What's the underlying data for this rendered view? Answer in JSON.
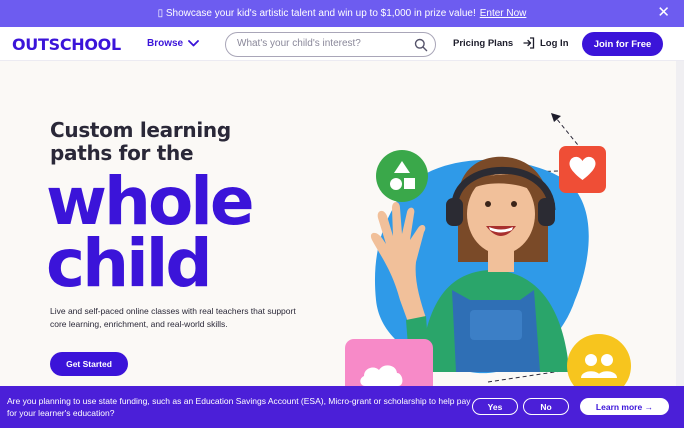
{
  "promo": {
    "text": "▯ Showcase your kid's artistic talent and win up to $1,000 in prize value!",
    "link": "Enter Now",
    "close": "✕"
  },
  "nav": {
    "logo": "OUTSCHOOL",
    "browse": "Browse",
    "search_placeholder": "What's your child's interest?",
    "pricing": "Pricing Plans",
    "login": "Log In",
    "join": "Join for Free"
  },
  "hero": {
    "line1": "Custom learning",
    "line2": "paths for the",
    "big1": "whole",
    "big2": "child",
    "desc": "Live and self-paced online classes with real teachers that support core learning, enrichment, and real-world skills.",
    "cta": "Get Started"
  },
  "banner": {
    "text": "Are you planning to use state funding, such as an Education Savings Account (ESA), Micro-grant or scholarship to help pay for your learner's education?",
    "yes": "Yes",
    "no": "No",
    "more": "Learn more →"
  },
  "colors": {
    "brand": "#3b14d9",
    "promo_bg": "#6d5cf0",
    "shapes_tile": "#3aa84a",
    "heart_tile": "#ef4e36",
    "people_tile": "#f7c51e",
    "cloud_tile": "#f78ac8",
    "blob": "#2f9ae8"
  },
  "icons": [
    "search-icon",
    "chevron-down-icon",
    "login-icon",
    "close-icon",
    "shapes-icon",
    "heart-icon",
    "people-icon",
    "cloud-icon",
    "arrow-icon"
  ]
}
